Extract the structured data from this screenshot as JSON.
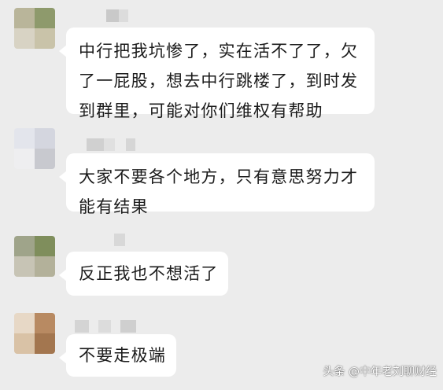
{
  "messages": [
    {
      "lines": [
        "中行把我坑惨了，实在活不了了，欠",
        "了一屁股，想去中行跳楼了，到时发",
        "到群里，可能对你们维权有帮助"
      ]
    },
    {
      "lines": [
        "大家不要各个地方，只有意思努力才",
        "能有结果"
      ]
    },
    {
      "lines": [
        "反正我也不想活了"
      ]
    },
    {
      "lines": [
        "不要走极端"
      ]
    }
  ],
  "watermark": "头条 @中年老刘聊财经",
  "colors": {
    "background": "#ececec",
    "bubble": "#ffffff",
    "text": "#1b1b1b"
  }
}
